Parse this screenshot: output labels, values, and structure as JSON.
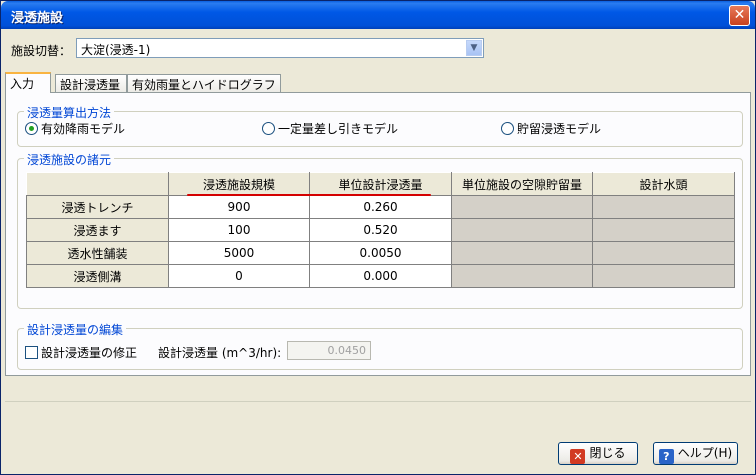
{
  "window": {
    "title": "浸透施設",
    "close_icon": "close-icon"
  },
  "switch": {
    "label": "施設切替：",
    "value": "大淀(浸透-1)"
  },
  "tabs": [
    {
      "label": "入力",
      "active": true
    },
    {
      "label": "設計浸透量",
      "active": false
    },
    {
      "label": "有効雨量とハイドログラフ",
      "active": false
    }
  ],
  "method": {
    "legend": "浸透量算出方法",
    "options": [
      {
        "label": "有効降雨モデル",
        "selected": true
      },
      {
        "label": "一定量差し引きモデル",
        "selected": false
      },
      {
        "label": "貯留浸透モデル",
        "selected": false
      }
    ]
  },
  "facility": {
    "legend": "浸透施設の諸元",
    "headers": [
      "浸透施設規模",
      "単位設計浸透量",
      "単位施設の空隙貯留量",
      "設計水頭"
    ],
    "rows": [
      {
        "name": "浸透トレンチ",
        "scale": "900",
        "unit": "0.260",
        "void": "",
        "head": ""
      },
      {
        "name": "浸透ます",
        "scale": "100",
        "unit": "0.520",
        "void": "",
        "head": ""
      },
      {
        "name": "透水性舗装",
        "scale": "5000",
        "unit": "0.0050",
        "void": "",
        "head": ""
      },
      {
        "name": "浸透側溝",
        "scale": "0",
        "unit": "0.000",
        "void": "",
        "head": ""
      }
    ]
  },
  "edit": {
    "legend": "設計浸透量の編集",
    "checkbox_label": "設計浸透量の修正",
    "field_label": "設計浸透量 (m^3/hr):",
    "field_value": "0.0450"
  },
  "buttons": {
    "close": "閉じる",
    "help": "ヘルプ(H)"
  },
  "colors": {
    "accent": "#0046d5",
    "highlight": "#d40000",
    "title_bar": "#0058e6"
  }
}
